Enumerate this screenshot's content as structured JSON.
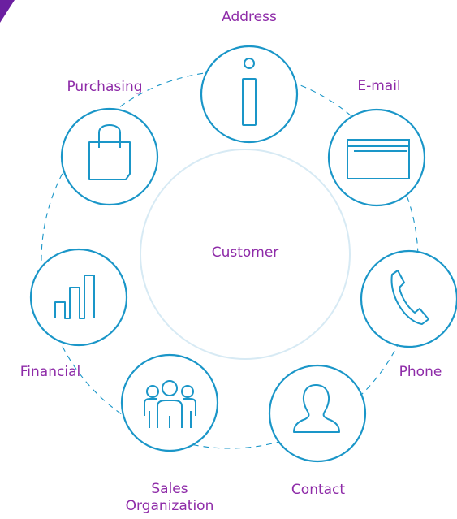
{
  "center": {
    "label": "Customer"
  },
  "nodes": [
    {
      "key": "address",
      "label": "Address",
      "icon": "info-icon"
    },
    {
      "key": "email",
      "label": "E-mail",
      "icon": "browser-window-icon"
    },
    {
      "key": "phone",
      "label": "Phone",
      "icon": "phone-icon"
    },
    {
      "key": "contact",
      "label": "Contact",
      "icon": "person-icon"
    },
    {
      "key": "sales",
      "label_line1": "Sales",
      "label_line2": "Organization",
      "icon": "group-icon"
    },
    {
      "key": "financial",
      "label": "Financial",
      "icon": "bar-chart-icon"
    },
    {
      "key": "purchasing",
      "label": "Purchasing",
      "icon": "shopping-bag-icon"
    }
  ],
  "colors": {
    "node_stroke": "#1a96c8",
    "inner_circle": "#d7eaf4",
    "label_text": "#8e2ba8",
    "corner_accent": "#6b1fa0"
  }
}
